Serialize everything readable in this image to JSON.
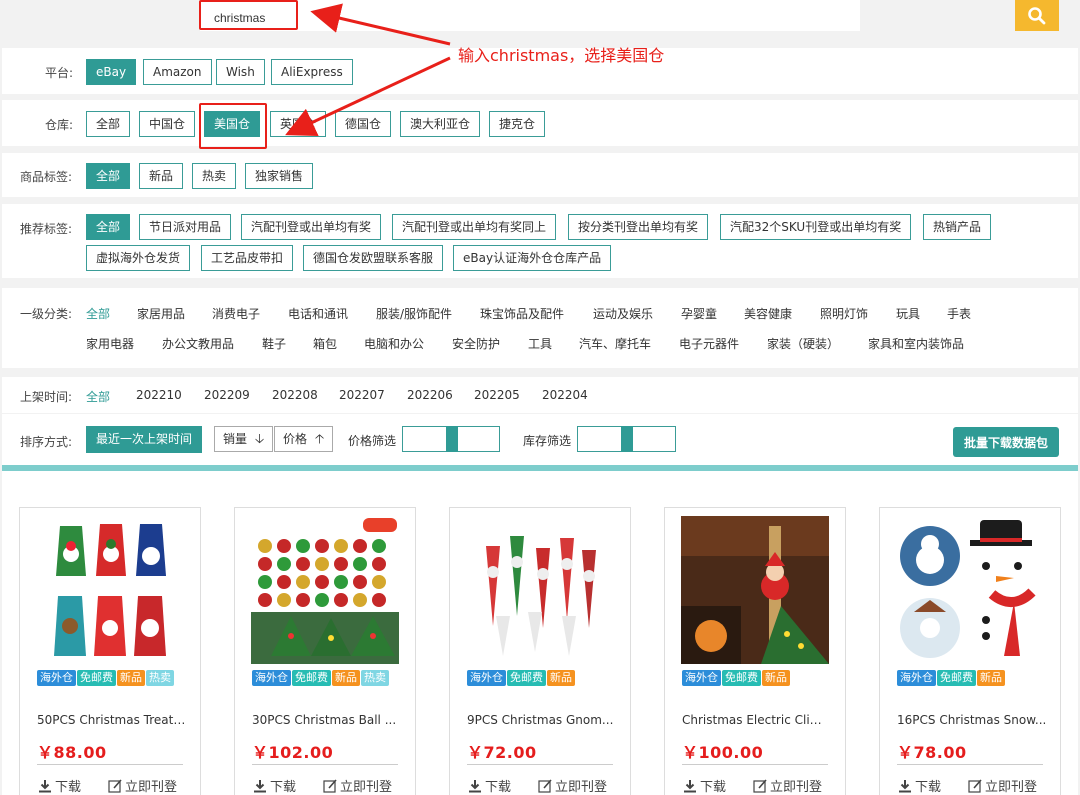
{
  "search": {
    "value": "christmas"
  },
  "annotation": {
    "text": "输入christmas，选择美国仓"
  },
  "platform": {
    "label": "平台:",
    "options": [
      "eBay",
      "Amazon",
      "Wish",
      "AliExpress"
    ],
    "selected": "eBay"
  },
  "warehouse": {
    "label": "仓库:",
    "options": [
      "全部",
      "中国仓",
      "美国仓",
      "英国仓",
      "德国仓",
      "澳大利亚仓",
      "捷克仓"
    ],
    "selected": "美国仓"
  },
  "product_tags": {
    "label": "商品标签:",
    "options": [
      "全部",
      "新品",
      "热卖",
      "独家销售"
    ],
    "selected": "全部"
  },
  "recommend_tags": {
    "label": "推荐标签:",
    "options": [
      "全部",
      "节日派对用品",
      "汽配刊登或出单均有奖",
      "汽配刊登或出单均有奖同上",
      "按分类刊登出单均有奖",
      "汽配32个SKU刊登或出单均有奖",
      "热销产品",
      "虚拟海外仓发货",
      "工艺品皮带扣",
      "德国仓发欧盟联系客服",
      "eBay认证海外仓仓库产品"
    ],
    "selected": "全部"
  },
  "category": {
    "label": "一级分类:",
    "options": [
      "全部",
      "家居用品",
      "消费电子",
      "电话和通讯",
      "服装/服饰配件",
      "珠宝饰品及配件",
      "运动及娱乐",
      "孕婴童",
      "美容健康",
      "照明灯饰",
      "玩具",
      "手表",
      "家用电器",
      "办公文教用品",
      "鞋子",
      "箱包",
      "电脑和办公",
      "安全防护",
      "工具",
      "汽车、摩托车",
      "电子元器件",
      "家装（硬装）",
      "家具和室内装饰品"
    ],
    "selected": "全部"
  },
  "listing_time": {
    "label": "上架时间:",
    "options": [
      "全部",
      "202210",
      "202209",
      "202208",
      "202207",
      "202206",
      "202205",
      "202204"
    ],
    "selected": "全部"
  },
  "sort": {
    "label": "排序方式:",
    "latest": "最近一次上架时间",
    "sales": "销量",
    "price": "价格",
    "price_filter": "价格筛选",
    "stock_filter": "库存筛选",
    "batch_download": "批量下载数据包"
  },
  "products": [
    {
      "title": "50PCS Christmas Treat ...",
      "price": "￥88.00",
      "badges": [
        "海外仓",
        "免邮费",
        "新品",
        "热卖"
      ],
      "download": "下载",
      "publish": "立即刊登"
    },
    {
      "title": "30PCS Christmas Ball ...",
      "price": "￥102.00",
      "badges": [
        "海外仓",
        "免邮费",
        "新品",
        "热卖"
      ],
      "download": "下载",
      "publish": "立即刊登"
    },
    {
      "title": "9PCS Christmas Gnom...",
      "price": "￥72.00",
      "badges": [
        "海外仓",
        "免邮费",
        "新品"
      ],
      "download": "下载",
      "publish": "立即刊登"
    },
    {
      "title": "Christmas Electric Clim...",
      "price": "￥100.00",
      "badges": [
        "海外仓",
        "免邮费",
        "新品"
      ],
      "download": "下载",
      "publish": "立即刊登"
    },
    {
      "title": "16PCS Christmas Snow...",
      "price": "￥78.00",
      "badges": [
        "海外仓",
        "免邮费",
        "新品"
      ],
      "download": "下载",
      "publish": "立即刊登"
    }
  ],
  "colors": {
    "accent": "#2f9b95",
    "price": "#e51d1d",
    "annotation": "#e8201a",
    "search_button": "#f5b82e"
  }
}
